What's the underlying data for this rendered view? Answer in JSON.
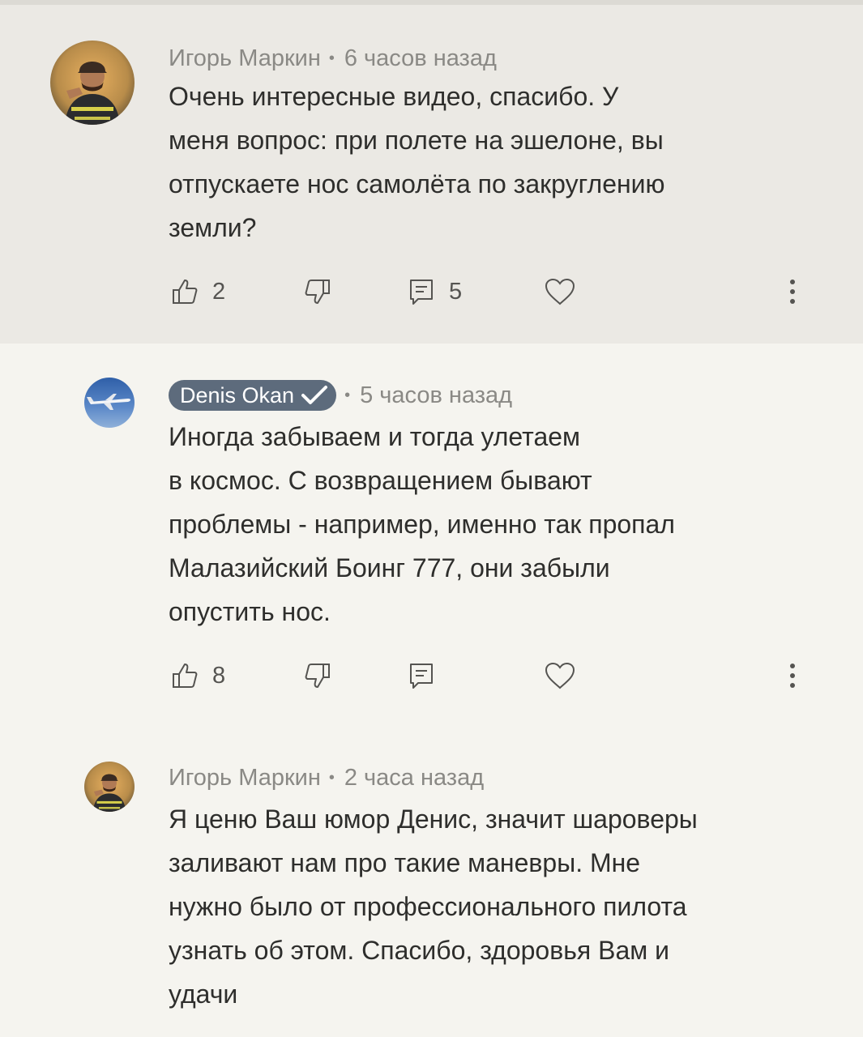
{
  "comments": [
    {
      "author": "Игорь Маркин",
      "time": "6 часов назад",
      "lines": [
        "Очень интересные видео, спасибо. У",
        "меня вопрос: при полете на эшелоне, вы",
        "отпускаете нос самолёта по закруглению",
        "земли?"
      ],
      "likes": "2",
      "replies": "5",
      "avatar_icon": "firefighter-avatar"
    },
    {
      "author": "Denis Okan",
      "verified": true,
      "time": "5 часов назад",
      "lines": [
        "Иногда забываем и тогда улетаем",
        "в космос. С возвращением бывают",
        "проблемы - например, именно так пропал",
        "Малазийский Боинг 777, они забыли",
        "опустить нос."
      ],
      "likes": "8",
      "replies": "",
      "avatar_icon": "airplane-avatar"
    },
    {
      "author": "Игорь Маркин",
      "time": "2 часа назад",
      "lines": [
        "Я ценю Ваш юмор Денис, значит шароверы",
        "заливают нам про такие маневры. Мне",
        "нужно было от профессионального пилота",
        "узнать об этом.  Спасибо, здоровья Вам и",
        "удачи"
      ],
      "avatar_icon": "firefighter-avatar"
    }
  ],
  "colors": {
    "highlight_bg": "#ebe9e4",
    "page_bg": "#f5f4ef",
    "badge_bg": "#5d6b7c",
    "text": "#2e2e2c",
    "meta": "#8a8985"
  }
}
